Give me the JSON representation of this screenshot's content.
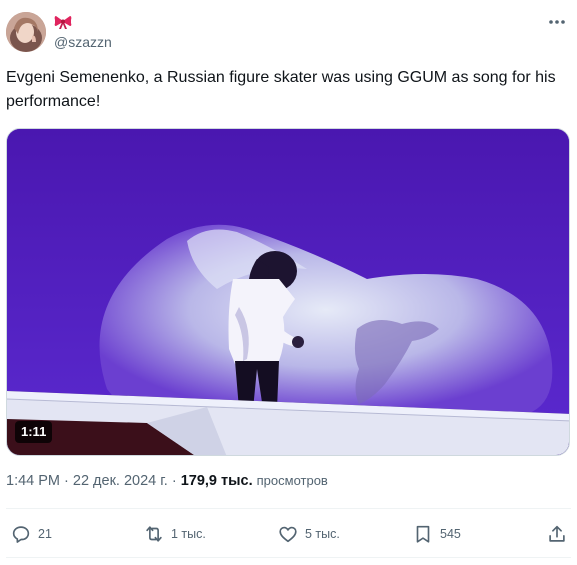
{
  "tweet": {
    "display_name_emoji": "bow",
    "handle": "@szazzn",
    "text": "Evgeni Semenenko, a Russian figure skater was using GGUM as song for his performance!",
    "video_duration": "1:11",
    "time": "1:44 PM",
    "date": "22 дек. 2024 г.",
    "views_count": "179,9 тыс.",
    "views_label": "просмотров"
  },
  "actions": {
    "replies": "21",
    "reposts": "1 тыс.",
    "likes": "5 тыс.",
    "bookmarks": "545"
  },
  "icons": {
    "more": "more-dots-icon",
    "reply": "reply-bubble-icon",
    "repost": "repost-arrows-icon",
    "like": "heart-icon",
    "bookmark": "bookmark-icon",
    "share": "share-upload-icon"
  },
  "colors": {
    "text_primary": "#0f1419",
    "text_secondary": "#536471",
    "video_purple": "#4f1fb8",
    "bow_red": "#e0245e"
  }
}
